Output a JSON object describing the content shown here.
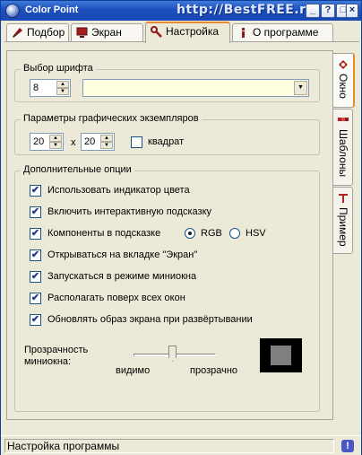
{
  "window": {
    "title": "Color Point",
    "watermark": "http://BestFREE.ru",
    "buttons": {
      "minimize": "_",
      "help": "?",
      "maximize": "□",
      "close": "×"
    }
  },
  "top_tabs": [
    {
      "label": "Подбор",
      "icon": "brush-icon"
    },
    {
      "label": "Экран",
      "icon": "monitor-icon"
    },
    {
      "label": "Настройка",
      "icon": "wrench-icon",
      "active": true
    },
    {
      "label": "О программе",
      "icon": "info-icon"
    }
  ],
  "font_group": {
    "title": "Выбор шрифта",
    "size_value": "8",
    "font_name_value": ""
  },
  "instances_group": {
    "title": "Параметры графических экземпляров",
    "width_value": "20",
    "separator": "x",
    "height_value": "20",
    "square_label": "квадрат",
    "square_checked": false
  },
  "options_group": {
    "title": "Дополнительные опции",
    "options": [
      {
        "label": "Использовать индикатор цвета",
        "checked": true
      },
      {
        "label": "Включить интерактивную подсказку",
        "checked": true
      },
      {
        "label": "Компоненты в подсказке",
        "checked": true
      },
      {
        "label": "Открываться на вкладке \"Экран\"",
        "checked": true
      },
      {
        "label": "Запускаться в режиме миниокна",
        "checked": true
      },
      {
        "label": "Располагать поверх всех окон",
        "checked": true
      },
      {
        "label": "Обновлять образ экрана при развёртывании",
        "checked": true
      }
    ],
    "color_model": {
      "rgb_label": "RGB",
      "hsv_label": "HSV",
      "selected": "RGB"
    },
    "transparency": {
      "label_line1": "Прозрачность",
      "label_line2": "миниокна:",
      "min_label": "видимо",
      "max_label": "прозрачно",
      "value_fraction": 0.47
    }
  },
  "side_tabs": [
    {
      "label": "Окно",
      "icon": "window-icon",
      "active": true
    },
    {
      "label": "Шаблоны",
      "icon": "palette-icon"
    },
    {
      "label": "Пример",
      "icon": "text-t-icon"
    }
  ],
  "status": {
    "text": "Настройка программы",
    "icon": "info-exclamation-icon"
  },
  "colors": {
    "titlebar": "#1d4fbe",
    "face": "#ECE9D8",
    "active_tab_accent": "#e68b2c",
    "font_field_bg": "#ffffe0"
  }
}
